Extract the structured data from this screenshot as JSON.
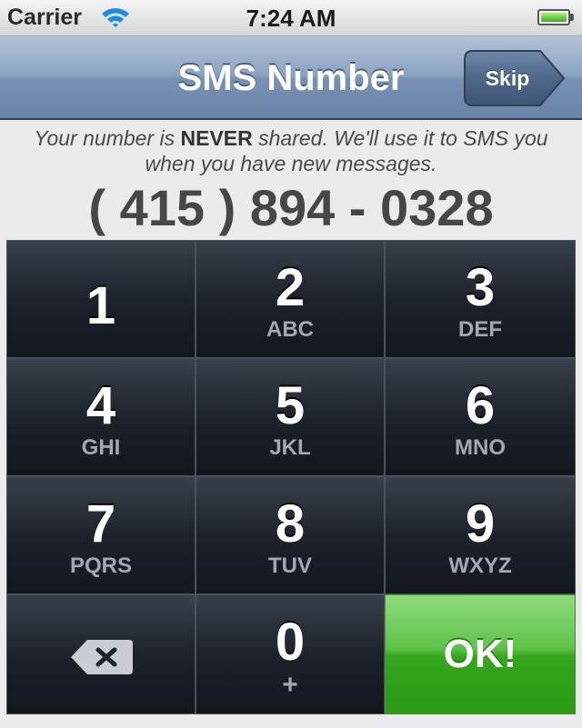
{
  "status_bar": {
    "carrier": "Carrier",
    "time": "7:24 AM"
  },
  "nav": {
    "title": "SMS Number",
    "skip_label": "Skip"
  },
  "info": {
    "prefix": "Your number is ",
    "emphasis": "NEVER",
    "suffix": " shared. We'll use it to SMS you when you have new messages."
  },
  "phone_number": "( 415 ) 894 - 0328",
  "keypad": {
    "keys": [
      {
        "digit": "1",
        "letters": ""
      },
      {
        "digit": "2",
        "letters": "ABC"
      },
      {
        "digit": "3",
        "letters": "DEF"
      },
      {
        "digit": "4",
        "letters": "GHI"
      },
      {
        "digit": "5",
        "letters": "JKL"
      },
      {
        "digit": "6",
        "letters": "MNO"
      },
      {
        "digit": "7",
        "letters": "PQRS"
      },
      {
        "digit": "8",
        "letters": "TUV"
      },
      {
        "digit": "9",
        "letters": "WXYZ"
      }
    ],
    "zero": {
      "digit": "0",
      "letters": "+"
    },
    "delete_icon": "backspace-icon",
    "ok_label": "OK!"
  },
  "colors": {
    "nav_bar": "#7791b3",
    "key_background": "#1d222b",
    "ok_green": "#34a51c"
  }
}
